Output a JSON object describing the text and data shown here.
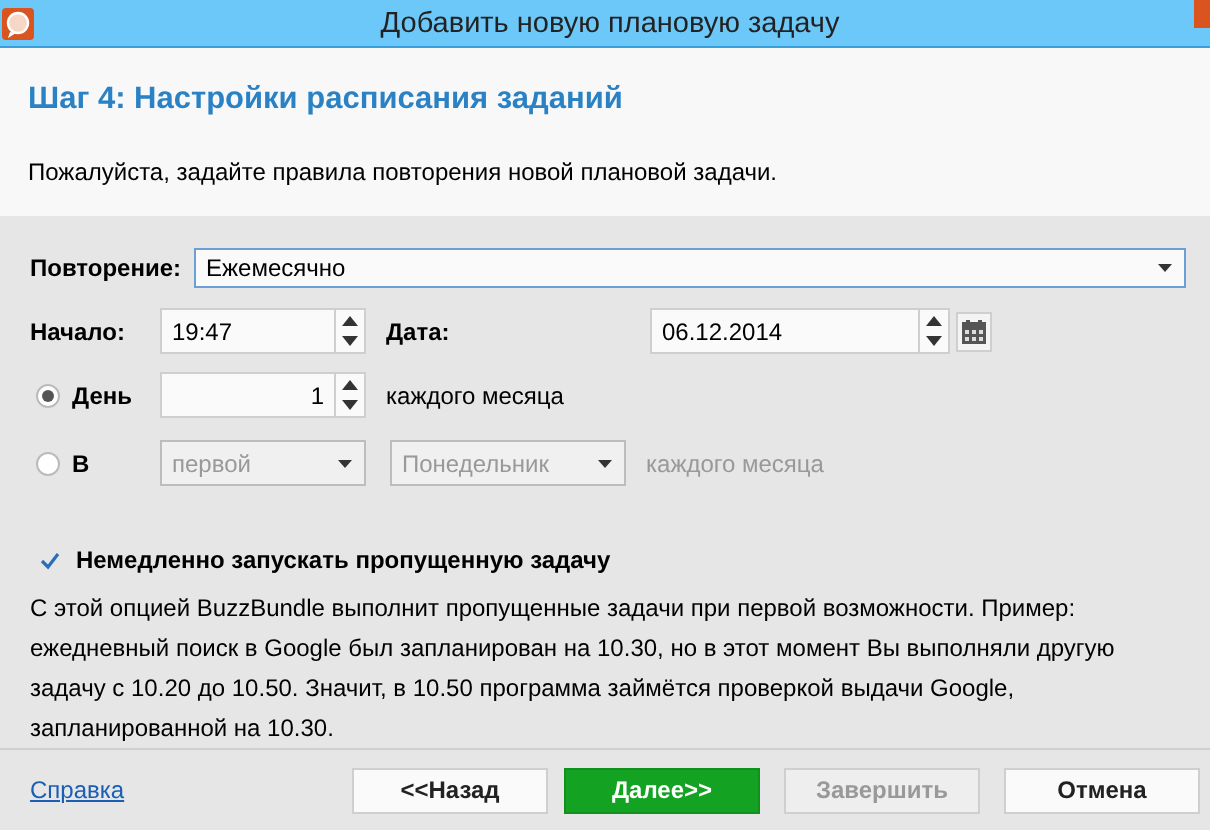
{
  "window": {
    "title": "Добавить новую плановую задачу"
  },
  "header": {
    "step_title": "Шаг 4: Настройки расписания заданий",
    "description": "Пожалуйста, задайте правила повторения новой плановой задачи."
  },
  "repeat": {
    "label": "Повторение:",
    "value": "Ежемесячно"
  },
  "start": {
    "label": "Начало:",
    "time": "19:47"
  },
  "date": {
    "label": "Дата:",
    "value": "06.12.2014"
  },
  "options": [
    {
      "kind": "day",
      "label": "День",
      "selected": true,
      "value": "1",
      "suffix": "каждого месяца"
    },
    {
      "kind": "weekday",
      "label": "В",
      "selected": false,
      "ordinal": "первой",
      "weekday": "Понедельник",
      "suffix": "каждого месяца"
    }
  ],
  "missed": {
    "label": "Немедленно запускать пропущенную задачу",
    "checked": true
  },
  "note": "С этой опцией BuzzBundle выполнит пропущенные задачи при первой возможности. Пример: ежедневный поиск в Google был запланирован на 10.30, но в этот момент Вы выполняли другую задачу с 10.20 до 10.50. Значит, в 10.50 программа займётся проверкой выдачи Google, запланированной на 10.30.",
  "footer": {
    "help": "Справка",
    "buttons": [
      {
        "label": "<<Назад",
        "primary": false,
        "disabled": false
      },
      {
        "label": "Далее>>",
        "primary": true,
        "disabled": false
      },
      {
        "label": "Завершить",
        "primary": false,
        "disabled": true
      },
      {
        "label": "Отмена",
        "primary": false,
        "disabled": false
      }
    ]
  }
}
